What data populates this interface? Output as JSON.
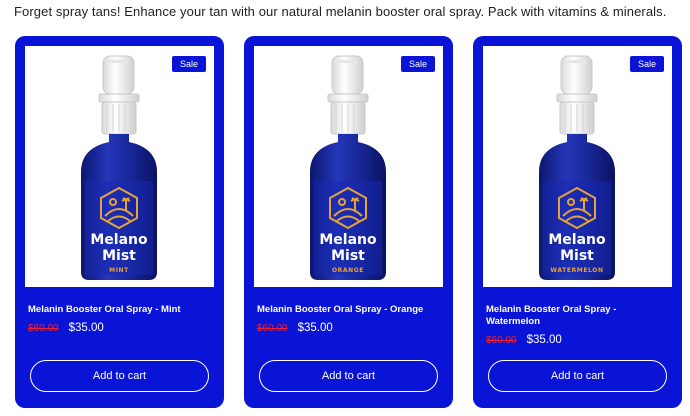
{
  "intro_text": "Forget spray tans! Enhance your tan with our natural melanin booster oral spray. Pack with vitamins & minerals.",
  "colors": {
    "card_bg": "#0a14d6",
    "compare_price": "#e8203a",
    "bottle": "#1a2aa0",
    "logo": "#e8a23a"
  },
  "products": [
    {
      "badge": "Sale",
      "brand": [
        "Melano",
        "Mist"
      ],
      "flavor": "MINT",
      "title": "Melanin Booster Oral Spray - Mint",
      "compare_price": "$60.00",
      "price": "$35.00",
      "button": "Add to cart"
    },
    {
      "badge": "Sale",
      "brand": [
        "Melano",
        "Mist"
      ],
      "flavor": "ORANGE",
      "title": "Melanin Booster Oral Spray - Orange",
      "compare_price": "$60.00",
      "price": "$35.00",
      "button": "Add to cart"
    },
    {
      "badge": "Sale",
      "brand": [
        "Melano",
        "Mist"
      ],
      "flavor": "WATERMELON",
      "title": "Melanin Booster Oral Spray - Watermelon",
      "compare_price": "$60.00",
      "price": "$35.00",
      "button": "Add to cart"
    }
  ]
}
